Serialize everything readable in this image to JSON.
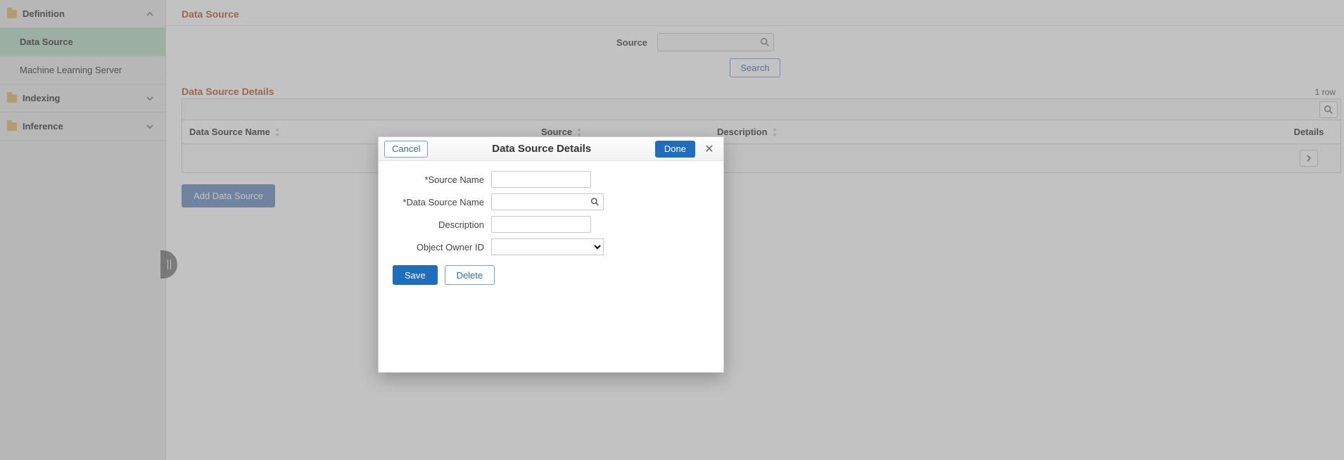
{
  "sidebar": {
    "sections": [
      {
        "label": "Definition",
        "expanded": true,
        "items": [
          {
            "label": "Data Source",
            "active": true
          },
          {
            "label": "Machine Learning Server",
            "active": false
          }
        ]
      },
      {
        "label": "Indexing",
        "expanded": false,
        "items": []
      },
      {
        "label": "Inference",
        "expanded": false,
        "items": []
      }
    ]
  },
  "main": {
    "page_title": "Data Source",
    "source_label": "Source",
    "search_button": "Search",
    "details_title": "Data Source Details",
    "row_count_label": "1 row",
    "columns": {
      "name": "Data Source Name",
      "source": "Source",
      "description": "Description",
      "details": "Details"
    },
    "add_button": "Add Data Source"
  },
  "modal": {
    "title": "Data Source Details",
    "cancel": "Cancel",
    "done": "Done",
    "fields": {
      "source_name_label": "Source Name",
      "data_source_name_label": "Data Source Name",
      "description_label": "Description",
      "object_owner_label": "Object Owner ID",
      "source_name_value": "",
      "data_source_name_value": "",
      "description_value": "",
      "object_owner_value": ""
    },
    "save": "Save",
    "delete": "Delete"
  },
  "icons": {
    "mag": "search-icon",
    "chev_up": "chevron-up-icon",
    "chev_down": "chevron-down-icon",
    "chev_right": "chevron-right-icon",
    "close": "close-icon"
  }
}
